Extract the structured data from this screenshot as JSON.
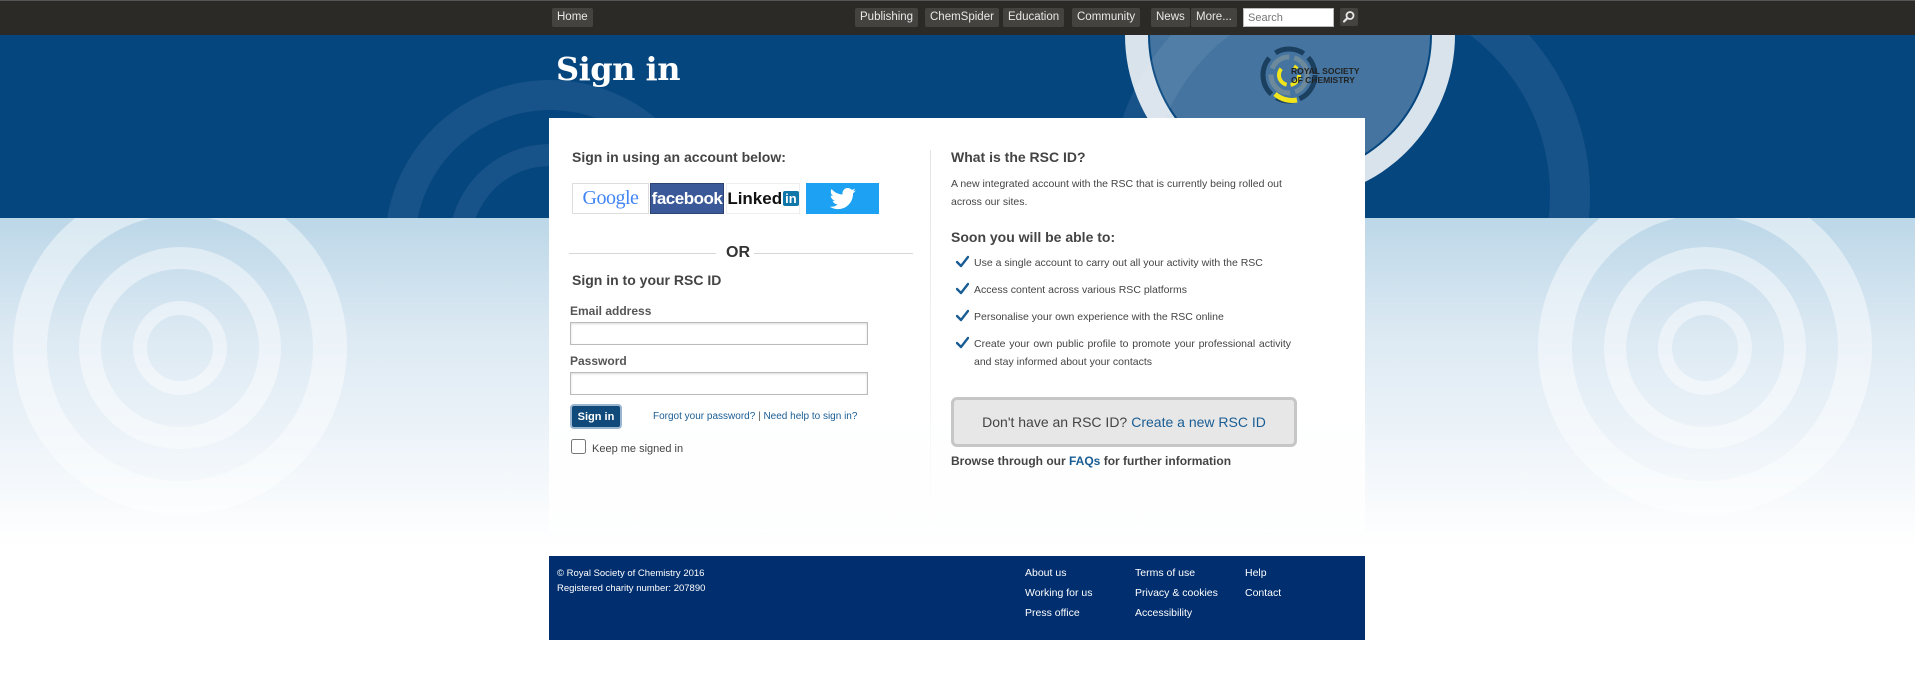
{
  "topnav": {
    "home": "Home",
    "items": [
      "Publishing",
      "ChemSpider",
      "Education",
      "Community",
      "News",
      "More..."
    ],
    "search_placeholder": "Search",
    "search_go_icon": "search-icon"
  },
  "header": {
    "title": "Sign in",
    "logo_line1": "ROYAL SOCIETY",
    "logo_line2": "OF CHEMISTRY"
  },
  "signin": {
    "accounts_heading": "Sign in using an account below:",
    "providers": [
      "Google",
      "facebook",
      "Linked",
      "in"
    ],
    "or": "OR",
    "rsc_heading": "Sign in to your RSC ID",
    "email_label": "Email address",
    "email_value": "",
    "password_label": "Password",
    "password_value": "",
    "signin_button": "Sign in",
    "forgot": "Forgot your password?",
    "separator": "|",
    "help": "Need help to sign in?",
    "keep_signed_in": "Keep me signed in"
  },
  "info": {
    "what_heading": "What is the RSC ID?",
    "what_text": "A new integrated account with the RSC that is currently being rolled out across our sites.",
    "soon_heading": "Soon you will be able to:",
    "features": [
      "Use a single account to carry out all your activity with the RSC",
      "Access content across various RSC platforms",
      "Personalise your own experience with the RSC online",
      "Create your own public profile to promote your professional activity and stay informed about your contacts"
    ],
    "cta_text": "Don't have an RSC ID?",
    "cta_link": "Create a new RSC ID",
    "browse_prefix": "Browse through our",
    "browse_link": "FAQs",
    "browse_suffix": "for further information"
  },
  "footer": {
    "copyright": "© Royal Society of Chemistry 2016",
    "charity": "Registered charity number: 207890",
    "col1": [
      "About us",
      "Working for us",
      "Press office"
    ],
    "col2": [
      "Terms of use",
      "Privacy & cookies",
      "Accessibility"
    ],
    "col3": [
      "Help",
      "Contact"
    ]
  },
  "colors": {
    "topbar": "#2b2a27",
    "hero_blue": "#06467f",
    "link_blue": "#1a5d94",
    "footer_navy": "#002e6e",
    "facebook": "#3b5998",
    "twitter": "#1da1f2",
    "linkedin": "#0e76a8"
  }
}
